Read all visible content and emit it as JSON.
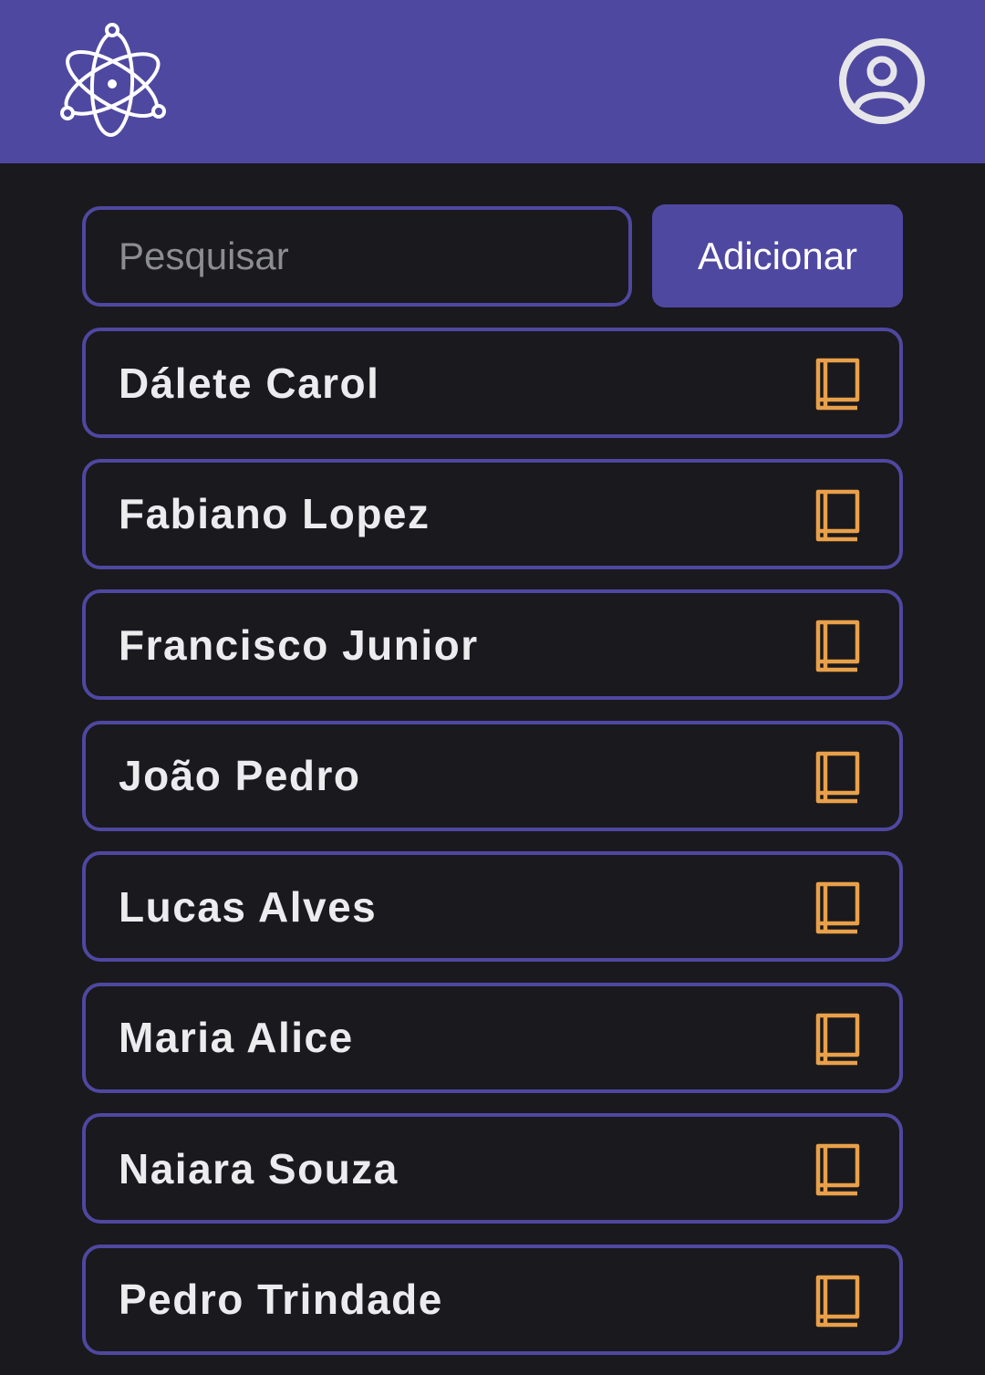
{
  "colors": {
    "accent": "#4f48a1",
    "background": "#1a191d",
    "icon": "#e8a04a",
    "text": "#ececee"
  },
  "header": {
    "logo_icon": "atom-logo-icon",
    "profile_icon": "user-circle-icon"
  },
  "search": {
    "placeholder": "Pesquisar",
    "value": ""
  },
  "add_button": {
    "label": "Adicionar"
  },
  "items": [
    {
      "label": "Dálete Carol",
      "icon": "book-icon"
    },
    {
      "label": "Fabiano Lopez",
      "icon": "book-icon"
    },
    {
      "label": "Francisco Junior",
      "icon": "book-icon"
    },
    {
      "label": "João Pedro",
      "icon": "book-icon"
    },
    {
      "label": "Lucas Alves",
      "icon": "book-icon"
    },
    {
      "label": "Maria Alice",
      "icon": "book-icon"
    },
    {
      "label": "Naiara Souza",
      "icon": "book-icon"
    },
    {
      "label": "Pedro Trindade",
      "icon": "book-icon"
    }
  ]
}
